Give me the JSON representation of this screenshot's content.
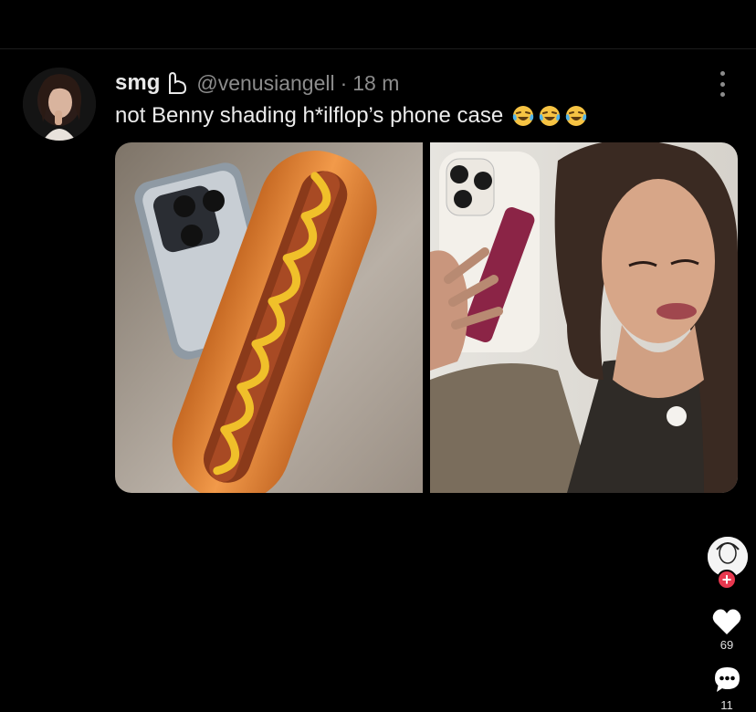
{
  "post": {
    "display_name": "smg",
    "handle": "@venusiangell",
    "separator": "·",
    "time": "18 m",
    "text": "not Benny shading h*ilflop’s phone case",
    "emoji_names": [
      "laughing-crying-emoji",
      "laughing-crying-emoji",
      "laughing-crying-emoji"
    ]
  },
  "sidebar": {
    "like_count": "69",
    "comment_count": "11",
    "follow_symbol": "+"
  },
  "colors": {
    "background": "#000000",
    "secondary_text": "#8c8c8c",
    "follow_red": "#e8384f"
  }
}
